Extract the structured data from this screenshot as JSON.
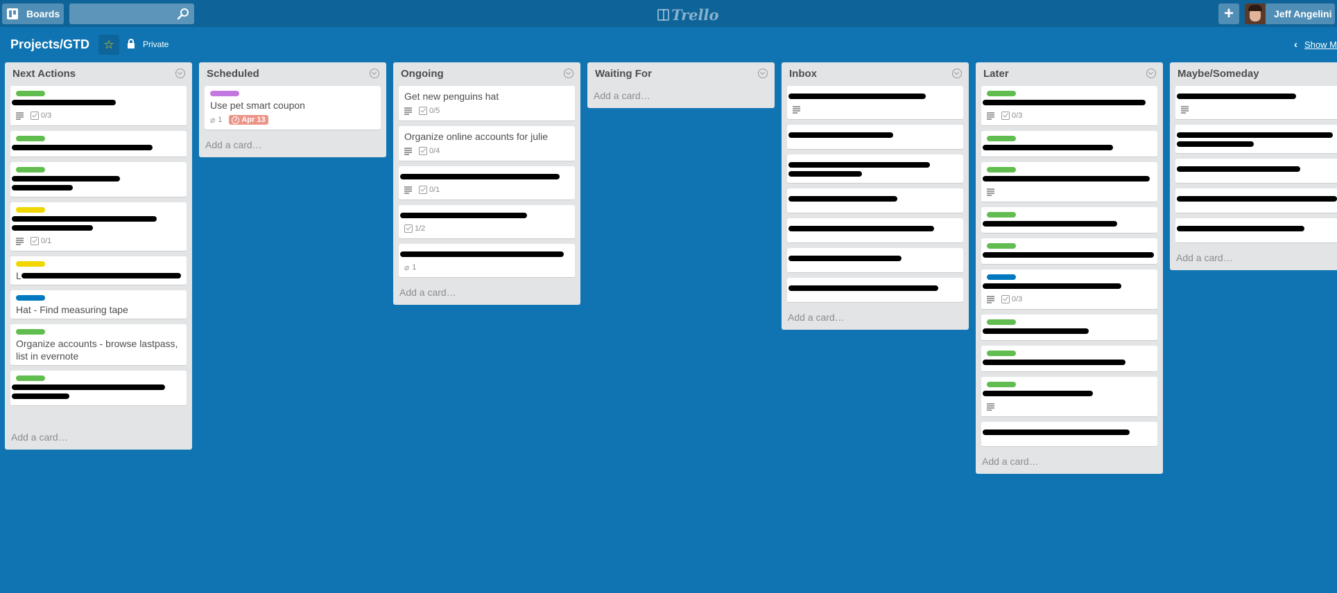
{
  "header": {
    "boards_label": "Boards",
    "search_placeholder": "",
    "logo_text": "Trello",
    "add_label": "+",
    "user_name": "Jeff Angelini"
  },
  "board": {
    "title": "Projects/GTD",
    "starred": true,
    "visibility": "Private",
    "show_menu_label": "Show Menu"
  },
  "colors": {
    "green": "#61bd4f",
    "yellow": "#f2d600",
    "blue": "#0079bf",
    "purple": "#c377e0",
    "due_overdue": "#ec9488"
  },
  "add_card_label": "Add a card…",
  "lists": [
    {
      "title": "Next Actions",
      "cards": [
        {
          "label": "green",
          "title": "[redacted]",
          "redacted_lines": 1,
          "desc": true,
          "checklist": "0/3"
        },
        {
          "label": "green",
          "title": "[redacted]",
          "redacted_lines": 1
        },
        {
          "label": "green",
          "title": "[redacted]",
          "redacted_lines": 2
        },
        {
          "label": "yellow",
          "title": "[redacted]",
          "redacted_lines": 2,
          "desc": true,
          "checklist": "0/1"
        },
        {
          "label": "yellow",
          "title": "L[redacted]",
          "redacted_lines": 1
        },
        {
          "label": "blue",
          "title": "Hat - Find measuring tape"
        },
        {
          "label": "green",
          "title": "Organize accounts - browse lastpass, list in evernote"
        },
        {
          "label": "green",
          "title": "[redacted]",
          "redacted_lines": 2
        }
      ]
    },
    {
      "title": "Scheduled",
      "cards": [
        {
          "label": "purple",
          "title": "Use pet smart coupon",
          "attachments": "1",
          "due": "Apr 13"
        }
      ]
    },
    {
      "title": "Ongoing",
      "cards": [
        {
          "title": "Get new penguins hat",
          "desc": true,
          "checklist": "0/5"
        },
        {
          "title": "Organize online accounts for julie",
          "desc": true,
          "checklist": "0/4"
        },
        {
          "title": "[redacted]",
          "redacted_lines": 1,
          "desc": true,
          "checklist": "0/1"
        },
        {
          "title": "[redacted]",
          "redacted_lines": 1,
          "checklist": "1/2"
        },
        {
          "title": "[redacted]",
          "redacted_lines": 1,
          "attachments": "1"
        }
      ]
    },
    {
      "title": "Waiting For",
      "cards": []
    },
    {
      "title": "Inbox",
      "cards": [
        {
          "title": "[redacted]",
          "redacted_lines": 1,
          "desc": true
        },
        {
          "title": "[redacted]",
          "redacted_lines": 1
        },
        {
          "title": "[redacted]",
          "redacted_lines": 2
        },
        {
          "title": "[redacted]",
          "redacted_lines": 1
        },
        {
          "title": "[redacted]",
          "redacted_lines": 1
        },
        {
          "title": "[redacted]",
          "redacted_lines": 1
        },
        {
          "title": "[redacted]",
          "redacted_lines": 1
        }
      ]
    },
    {
      "title": "Later",
      "cards": [
        {
          "label": "green",
          "title": "[redacted]",
          "redacted_lines": 1,
          "desc": true,
          "checklist": "0/3"
        },
        {
          "label": "green",
          "title": "[redacted]",
          "redacted_lines": 1
        },
        {
          "label": "green",
          "title": "[redacted]",
          "redacted_lines": 1,
          "desc": true
        },
        {
          "label": "green",
          "title": "[redacted]",
          "redacted_lines": 1
        },
        {
          "label": "green",
          "title": "[redacted]",
          "redacted_lines": 1
        },
        {
          "label": "blue",
          "title": "[redacted]",
          "redacted_lines": 1,
          "desc": true,
          "checklist": "0/3"
        },
        {
          "label": "green",
          "title": "[redacted]",
          "redacted_lines": 1
        },
        {
          "label": "green",
          "title": "[redacted]",
          "redacted_lines": 1
        },
        {
          "label": "green",
          "title": "[redacted]",
          "redacted_lines": 1,
          "desc": true
        },
        {
          "title": "[redacted]",
          "redacted_lines": 1
        }
      ]
    },
    {
      "title": "Maybe/Someday",
      "cards": [
        {
          "title": "[redacted]",
          "redacted_lines": 1,
          "desc": true
        },
        {
          "title": "[redacted]",
          "redacted_lines": 2
        },
        {
          "title": "[redacted]",
          "redacted_lines": 1
        },
        {
          "title": "[redacted]",
          "redacted_lines": 1
        },
        {
          "title": "[redacted]",
          "redacted_lines": 1
        }
      ]
    }
  ]
}
